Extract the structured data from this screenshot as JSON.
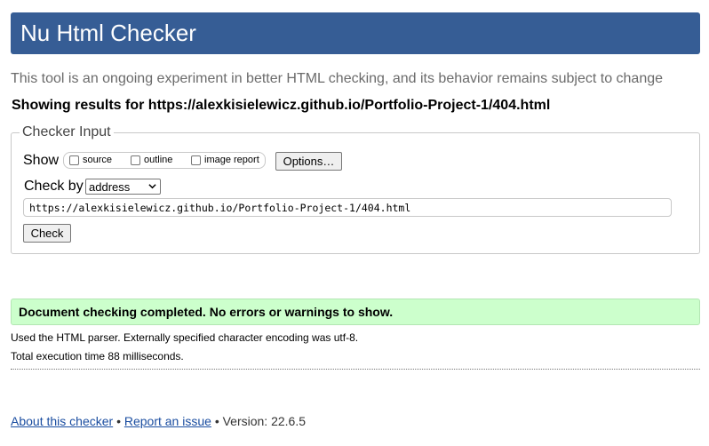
{
  "header": {
    "title": "Nu Html Checker"
  },
  "intro": "This tool is an ongoing experiment in better HTML checking, and its behavior remains subject to change",
  "showing": "Showing results for https://alexkisielewicz.github.io/Portfolio-Project-1/404.html",
  "checker": {
    "legend": "Checker Input",
    "show_label": "Show",
    "options": [
      {
        "label": "source",
        "checked": false
      },
      {
        "label": "outline",
        "checked": false
      },
      {
        "label": "image report",
        "checked": false
      }
    ],
    "options_button": "Options…",
    "check_by_label": "Check by",
    "check_by_value": "address",
    "url_value": "https://alexkisielewicz.github.io/Portfolio-Project-1/404.html",
    "check_button": "Check"
  },
  "result": {
    "success_message": "Document checking completed. No errors or warnings to show.",
    "parser_info": "Used the HTML parser. Externally specified character encoding was utf-8.",
    "execution_time": "Total execution time 88 milliseconds."
  },
  "footer": {
    "about_link": "About this checker",
    "separator": "•",
    "report_link": "Report an issue",
    "version": "Version: 22.6.5"
  },
  "colors": {
    "header_bg": "#365d95",
    "success_bg": "#ccffcc",
    "link": "#1a4da0"
  }
}
